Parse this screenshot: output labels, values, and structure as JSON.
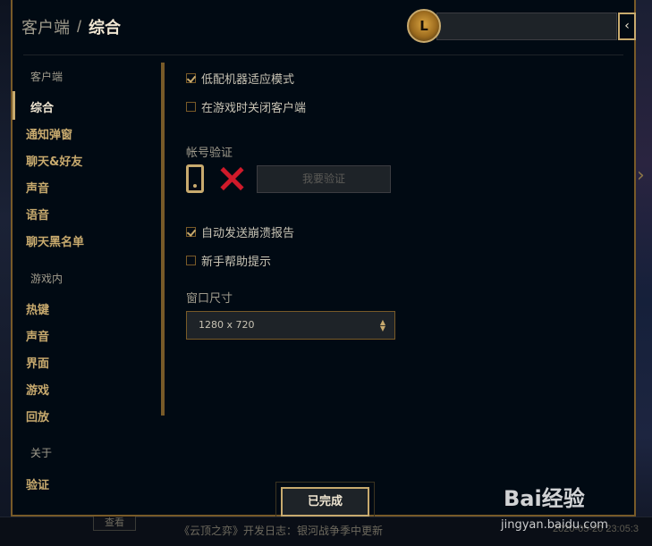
{
  "breadcrumb": {
    "section": "客户端",
    "separator": "/",
    "page": "综合"
  },
  "sidebar": {
    "client_heading": "客户端",
    "client_items": [
      "综合",
      "通知弹窗",
      "聊天&好友",
      "声音",
      "语音",
      "聊天黑名单"
    ],
    "ingame_heading": "游戏内",
    "ingame_items": [
      "热键",
      "声音",
      "界面",
      "游戏",
      "回放"
    ],
    "about_heading": "关于",
    "about_items": [
      "验证"
    ]
  },
  "settings": {
    "low_spec_mode": {
      "label": "低配机器适应模式",
      "checked": true
    },
    "close_client_in_game": {
      "label": "在游戏时关闭客户端",
      "checked": false
    },
    "account_verify_label": "帐号验证",
    "verify_button": "我要验证",
    "auto_crash_report": {
      "label": "自动发送崩溃报告",
      "checked": true
    },
    "newbie_tips": {
      "label": "新手帮助提示",
      "checked": false
    },
    "window_size_label": "窗口尺寸",
    "window_size_value": "1280 x 720"
  },
  "footer": {
    "done_button": "已完成"
  },
  "background": {
    "news_text": "《云顶之弈》开发日志：银河战争季中更新",
    "date_text": "2020-05-20 23:05:3",
    "view_button": "查看"
  },
  "watermark": {
    "logo": "Bai经验",
    "url": "jingyan.baidu.com"
  },
  "icons": {
    "avatar": "profile-avatar",
    "close": "chevron-left-icon",
    "phone": "phone-icon",
    "status": "x-mark-icon",
    "select": "updown-arrows-icon"
  },
  "colors": {
    "gold": "#c8aa6e",
    "gold_dark": "#785a28",
    "bg": "#010a13",
    "error_red": "#d01a2a"
  }
}
